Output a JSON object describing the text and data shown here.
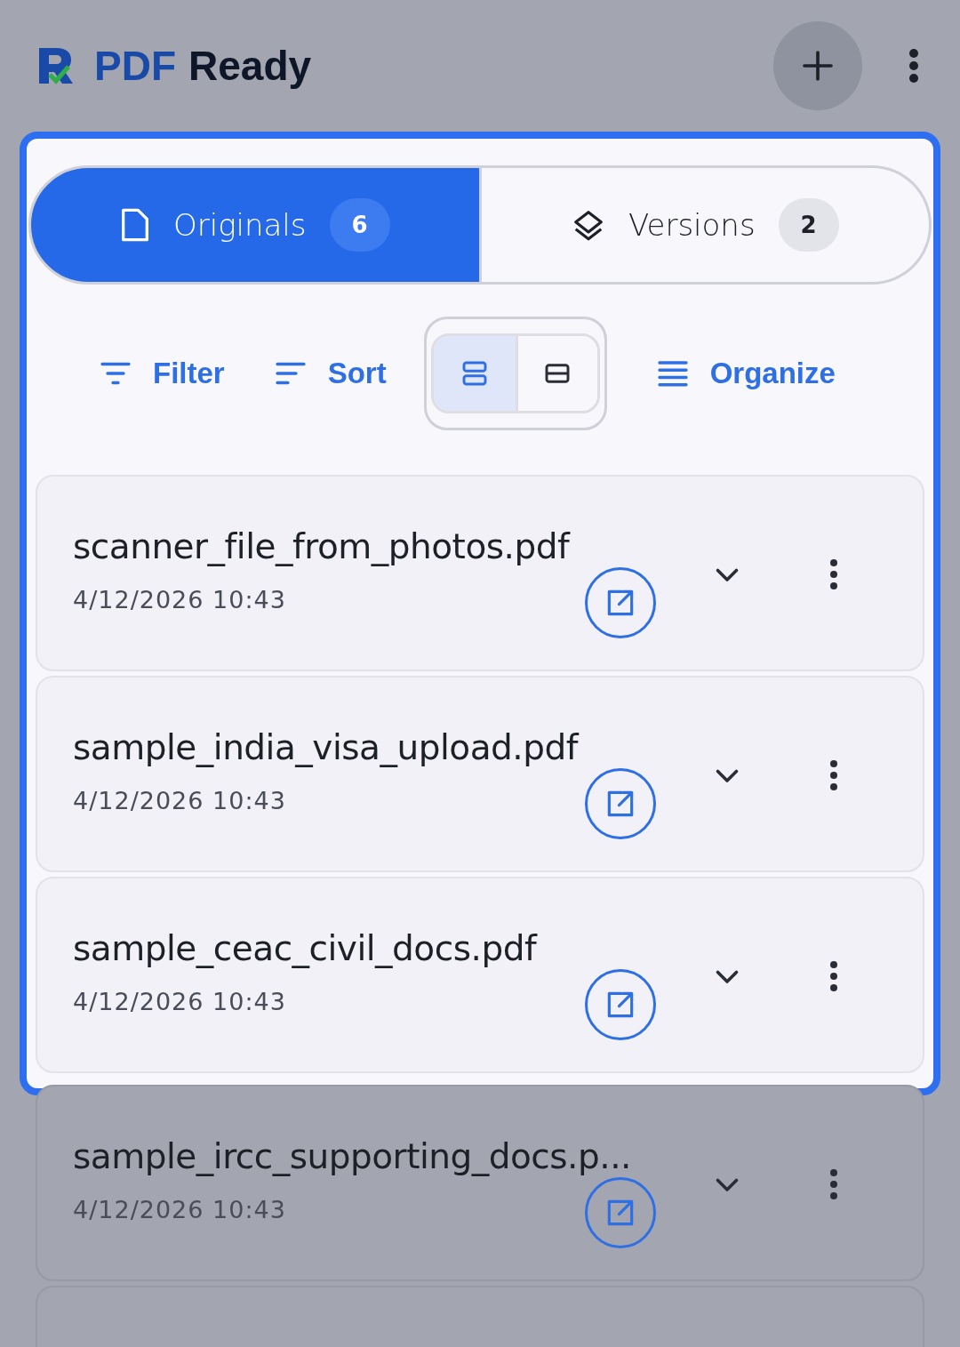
{
  "app_bar": {
    "brand_primary": "PDF",
    "brand_secondary": "Ready"
  },
  "tabs": [
    {
      "label": "Originals",
      "count": "6",
      "selected": true,
      "kind": "file"
    },
    {
      "label": "Versions",
      "count": "2",
      "selected": false,
      "kind": "layers"
    }
  ],
  "toolbar": {
    "filter": "Filter",
    "sort": "Sort",
    "organize": "Organize",
    "view_modes": [
      {
        "kind": "expanded",
        "selected": true
      },
      {
        "kind": "compact",
        "selected": false
      }
    ]
  },
  "files": [
    {
      "name": "scanner_file_from_photos.pdf",
      "date": "4/12/2026 10:43",
      "dimmed": false
    },
    {
      "name": "sample_india_visa_upload.pdf",
      "date": "4/12/2026 10:43",
      "dimmed": false
    },
    {
      "name": "sample_ceac_civil_docs.pdf",
      "date": "4/12/2026 10:43",
      "dimmed": false
    },
    {
      "name": "sample_ircc_supporting_docs.p...",
      "date": "4/12/2026 10:43",
      "dimmed": true
    }
  ]
}
